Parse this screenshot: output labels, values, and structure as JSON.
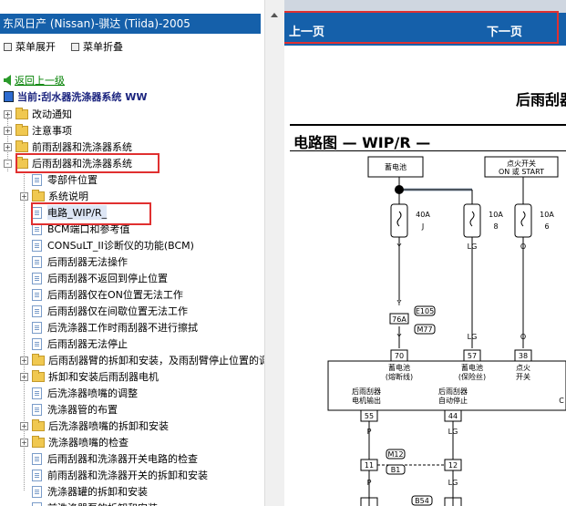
{
  "left": {
    "title": "东风日产 (Nissan)-骐达 (Tiida)-2005",
    "menu": {
      "expand": "菜单展开",
      "collapse": "菜单折叠"
    },
    "back": "返回上一级",
    "current": "当前:刮水器洗涤器系统 WW",
    "tree": [
      {
        "label": "改动通知",
        "type": "folder",
        "toggle": "+"
      },
      {
        "label": "注意事项",
        "type": "folder",
        "toggle": "+"
      },
      {
        "label": "前雨刮器和洗涤器系统",
        "type": "folder",
        "toggle": "+"
      },
      {
        "label": "后雨刮器和洗涤器系统",
        "type": "folder-open",
        "toggle": "-"
      },
      {
        "label": "零部件位置",
        "type": "doc"
      },
      {
        "label": "系统说明",
        "type": "folder",
        "toggle": "+"
      },
      {
        "label": "电路_WIP/R_",
        "type": "doc",
        "selected": true
      },
      {
        "label": "BCM端口和参考值",
        "type": "doc"
      },
      {
        "label": "CONSuLT_II诊断仪的功能(BCM)",
        "type": "doc"
      },
      {
        "label": "后雨刮器无法操作",
        "type": "doc"
      },
      {
        "label": "后雨刮器不返回到停止位置",
        "type": "doc"
      },
      {
        "label": "后雨刮器仅在ON位置无法工作",
        "type": "doc"
      },
      {
        "label": "后雨刮器仅在间歇位置无法工作",
        "type": "doc"
      },
      {
        "label": "后洗涤器工作时雨刮器不进行擦拭",
        "type": "doc"
      },
      {
        "label": "后雨刮器无法停止",
        "type": "doc"
      },
      {
        "label": "后雨刮器臂的拆卸和安装，及雨刮臂停止位置的调",
        "type": "folder",
        "toggle": "+"
      },
      {
        "label": "拆卸和安装后雨刮器电机",
        "type": "folder",
        "toggle": "+"
      },
      {
        "label": "后洗涤器喷嘴的调整",
        "type": "doc"
      },
      {
        "label": "洗涤器管的布置",
        "type": "doc"
      },
      {
        "label": "后洗涤器喷嘴的拆卸和安装",
        "type": "folder",
        "toggle": "+"
      },
      {
        "label": "洗涤器喷嘴的检查",
        "type": "folder",
        "toggle": "+"
      },
      {
        "label": "后雨刮器和洗涤器开关电路的检查",
        "type": "doc"
      },
      {
        "label": "前雨刮器和洗涤器开关的拆卸和安装",
        "type": "doc"
      },
      {
        "label": "洗涤器罐的拆卸和安装",
        "type": "doc"
      },
      {
        "label": "前洗涤器泵的拆卸和安装",
        "type": "doc"
      }
    ]
  },
  "right": {
    "prev": "上一页",
    "next": "下一页",
    "page_title": "后雨刮器",
    "diagram_title": "电路图 — WIP/R —",
    "diagram": {
      "battery": "蓄电池",
      "ignition": "点火开关",
      "ignition_pos": "ON 或 START",
      "fuse1": "40A",
      "fuse1_id": "J",
      "fuse2": "10A",
      "fuse2_id": "8",
      "fuse3": "10A",
      "fuse3_id": "6",
      "wire_y": "Y",
      "wire_lg": "LG",
      "wire_o": "O",
      "wire_p": "P",
      "conn_e105": "E105",
      "conn_m77": "M77",
      "conn_m12": "M12",
      "conn_b1": "B1",
      "conn_b54": "B54",
      "pin_76a": "76A",
      "pin_70": "70",
      "pin_57": "57",
      "pin_38": "38",
      "pin_55": "55",
      "pin_44": "44",
      "pin_11": "11",
      "pin_12": "12",
      "lbl_bat_fuse": "蓄电池",
      "lbl_bat_fuse2": "(熔断线)",
      "lbl_bat_safe": "蓄电池",
      "lbl_bat_safe2": "(保险丝)",
      "lbl_ign": "点火",
      "lbl_ign2": "开关",
      "lbl_motor": "后雨刮器",
      "lbl_motor2": "电机输出",
      "lbl_auto": "后雨刮器",
      "lbl_auto2": "自动停止",
      "lbl_c": "C"
    }
  }
}
